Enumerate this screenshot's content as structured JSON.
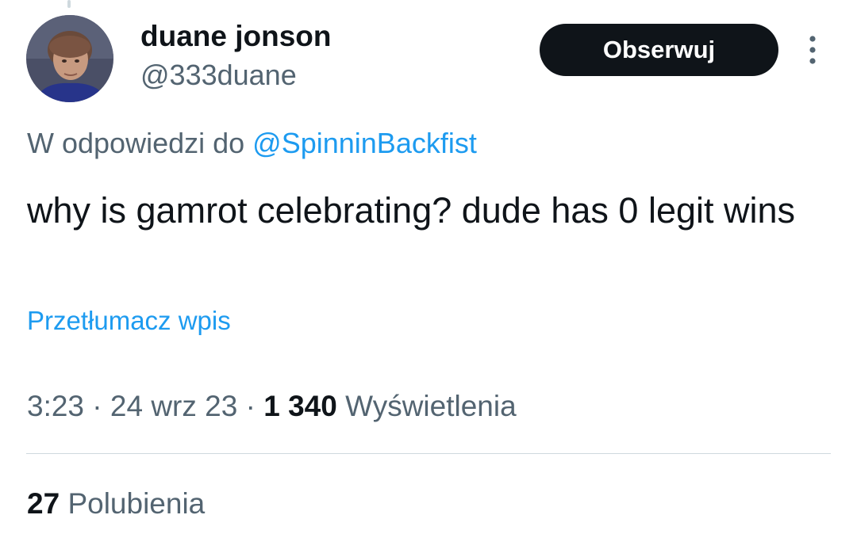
{
  "author": {
    "name": "duane jonson",
    "handle": "@333duane"
  },
  "follow_button": {
    "label": "Obserwuj"
  },
  "more_menu": {
    "icon": "more-vertical-icon"
  },
  "reply_context": {
    "prefix": "W odpowiedzi do",
    "mention": "@SpinninBackfist"
  },
  "tweet": {
    "text": "why is gamrot celebrating? dude has 0 legit wins",
    "translate_label": "Przetłumacz wpis"
  },
  "meta": {
    "time": "3:23",
    "date": "24 wrz 23",
    "separator": " · ",
    "views_count": "1 340",
    "views_label": "Wyświetlenia"
  },
  "stats": {
    "likes_count": "27",
    "likes_label": "Polubienia"
  },
  "colors": {
    "text_primary": "#0f1419",
    "text_secondary": "#536471",
    "link": "#1d9bf0",
    "divider": "#cfd9de",
    "button_bg": "#0f1419"
  }
}
